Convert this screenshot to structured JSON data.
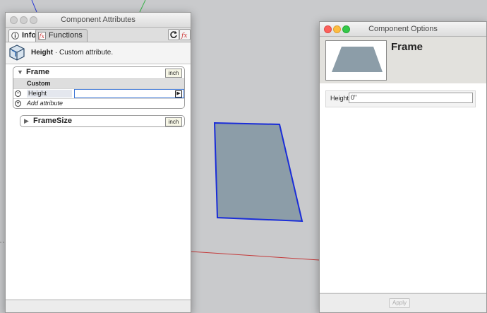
{
  "attributes_window": {
    "title": "Component Attributes",
    "tabs": [
      {
        "label": "Info",
        "active": true,
        "icon": "info-icon"
      },
      {
        "label": "Functions",
        "active": false,
        "icon": "function-icon"
      }
    ],
    "toolbar_icons": [
      "refresh-icon",
      "formula-icon"
    ],
    "info": {
      "attribute_name": "Height",
      "separator": " · ",
      "description": "Custom attribute."
    },
    "groups": [
      {
        "name": "Frame",
        "expanded": true,
        "unit": "inch",
        "section": "Custom",
        "rows": [
          {
            "label": "Height",
            "value": ""
          },
          {
            "label": "Add attribute",
            "value": ""
          }
        ]
      },
      {
        "name": "FrameSize",
        "expanded": false,
        "unit": "inch"
      }
    ]
  },
  "options_window": {
    "title": "Component Options",
    "component_name": "Frame",
    "fields": [
      {
        "label": "Height",
        "value": "0\""
      }
    ],
    "apply_label": "Apply"
  },
  "colors": {
    "selection_blue": "#1a2dd8",
    "shape_fill": "#8c9da8",
    "axis_red": "#c43a3a",
    "axis_green": "#3bb34a",
    "axis_blue": "#2a3bd6"
  }
}
